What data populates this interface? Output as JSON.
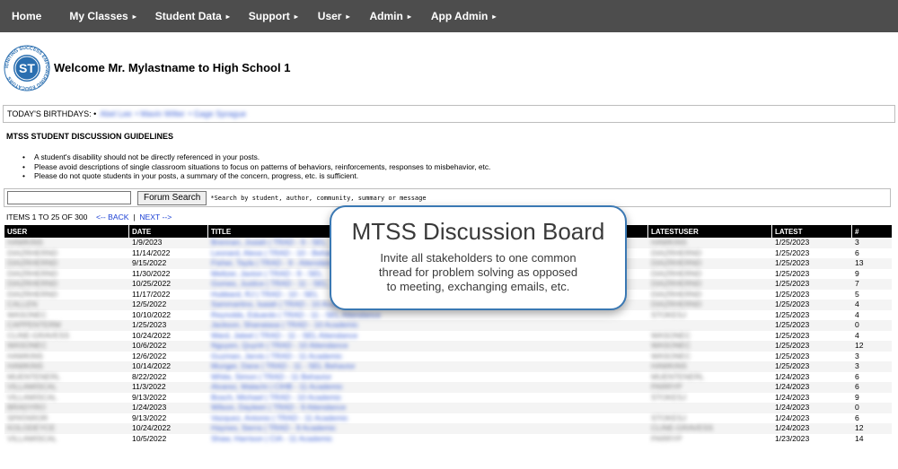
{
  "nav": {
    "home": "Home",
    "my_classes": "My Classes",
    "student_data": "Student Data",
    "support": "Support",
    "user": "User",
    "admin": "Admin",
    "app_admin": "App Admin",
    "arrow": "▸"
  },
  "header": {
    "welcome": "Welcome Mr. Mylastname to High School 1",
    "logo_text": "ST",
    "logo_ring_text": "IGNITING SUCCESS EMPOWERING EDUCATORS"
  },
  "birthdays": {
    "label": "TODAY'S BIRTHDAYS: •",
    "names": [
      "Abel Lee",
      "• Mavin Wilter",
      "• Gage Sprague"
    ]
  },
  "guidelines": {
    "title": "MTSS STUDENT DISCUSSION GUIDELINES",
    "items": [
      "A student's disability should not be directly referenced in your posts.",
      "Please avoid descriptions of single classroom situations to focus on patterns of behaviors, reinforcements, responses to misbehavior, etc.",
      "Please do not quote students in your posts, a summary of the concern, progress, etc. is sufficient."
    ]
  },
  "search": {
    "value": "",
    "button": "Forum Search",
    "hint": "*Search by student, author, community, summary or message"
  },
  "pagination": {
    "items_text": "ITEMS 1 TO 25 OF 300",
    "back": "<-- BACK",
    "separator": "|",
    "next": "NEXT -->"
  },
  "table": {
    "headers": {
      "user": "USER",
      "date": "DATE",
      "title": "TITLE",
      "lastuser": "LATESTUSER",
      "latest": "LATEST",
      "count": "#"
    },
    "rows": [
      {
        "user": "HAWKINS",
        "date": "1/9/2023",
        "title": "Brennan, Josiah | TRAD - 9 - SEL",
        "lastuser": "HAWKINS",
        "latest": "1/25/2023",
        "count": "3"
      },
      {
        "user": "DIAZRHERND",
        "date": "11/14/2022",
        "title": "Leonard, Alexa | TRAD - 10 - Behavior",
        "lastuser": "DIAZRHERND",
        "latest": "1/25/2023",
        "count": "6"
      },
      {
        "user": "DIAZRHERND",
        "date": "9/15/2022",
        "title": "Fisher, Tayla | TRAD - 9 - Attendance",
        "lastuser": "DIAZRHERND",
        "latest": "1/25/2023",
        "count": "13"
      },
      {
        "user": "DIAZRHERND",
        "date": "11/30/2022",
        "title": "Meltzer, Jaxton | TRAD - 9 - SEL",
        "lastuser": "DIAZRHERND",
        "latest": "1/25/2023",
        "count": "9"
      },
      {
        "user": "DIAZRHERND",
        "date": "10/25/2022",
        "title": "Gomes, Justice | TRAD - 11 - SEL",
        "lastuser": "DIAZRHERND",
        "latest": "1/25/2023",
        "count": "7"
      },
      {
        "user": "DIAZRHERND",
        "date": "11/17/2022",
        "title": "Hubbard, RJ | TRAD - 10 - SEL",
        "lastuser": "DIAZRHERND",
        "latest": "1/25/2023",
        "count": "5"
      },
      {
        "user": "CALLEN",
        "date": "12/5/2022",
        "title": "Sammartino, Isaiah | TRAD - 10 Academic",
        "lastuser": "DIAZRHERND",
        "latest": "1/25/2023",
        "count": "4"
      },
      {
        "user": "WASONEC",
        "date": "10/10/2022",
        "title": "Reynolds, Eduardo | TRAD - 11 - SEL Attendance",
        "lastuser": "STOKESJ",
        "latest": "1/25/2023",
        "count": "4"
      },
      {
        "user": "CAPPENTERM",
        "date": "1/25/2023",
        "title": "Jackson, Shanaiasa | TRAD - 10 Academic",
        "lastuser": "",
        "latest": "1/25/2023",
        "count": "0"
      },
      {
        "user": "CLINE-GRAVESS",
        "date": "10/24/2022",
        "title": "Ward, Jaleel | TRAD - 11 - SEL Attendance",
        "lastuser": "WASONEC",
        "latest": "1/25/2023",
        "count": "4"
      },
      {
        "user": "WASONEC",
        "date": "10/6/2022",
        "title": "Nguyen, Quynh | TRAD - 10 Attendance",
        "lastuser": "WASONEC",
        "latest": "1/25/2023",
        "count": "12"
      },
      {
        "user": "HAWKINS",
        "date": "12/6/2022",
        "title": "Guzman, Jarvis | TRAD - 11 Academic",
        "lastuser": "WASONEC",
        "latest": "1/25/2023",
        "count": "3"
      },
      {
        "user": "HAWKINS",
        "date": "10/14/2022",
        "title": "Munger, Dane | TRAD - 11 - SEL Behavior",
        "lastuser": "HAWKINS",
        "latest": "1/25/2023",
        "count": "3"
      },
      {
        "user": "MUENTENERL",
        "date": "8/22/2022",
        "title": "White, Simon | TRAD - 11 Behavior",
        "lastuser": "MUENTENERL",
        "latest": "1/24/2023",
        "count": "6"
      },
      {
        "user": "VILLAMISCAL",
        "date": "11/3/2022",
        "title": "Alvarez, Malachi | CIHB - 11 Academic",
        "lastuser": "PARRYP",
        "latest": "1/24/2023",
        "count": "6"
      },
      {
        "user": "VILLAMISCAL",
        "date": "9/13/2022",
        "title": "Bosch, Michael | TRAD - 10 Academic",
        "lastuser": "STOKESJ",
        "latest": "1/24/2023",
        "count": "9"
      },
      {
        "user": "BRADYRO",
        "date": "1/24/2023",
        "title": "Wilson, Dayleen | TRAD - 9 Attendance",
        "lastuser": "",
        "latest": "1/24/2023",
        "count": "0"
      },
      {
        "user": "SPATAROR",
        "date": "9/13/2022",
        "title": "Vazquez, Antonio | TRAD - 11 Academic",
        "lastuser": "STOKESJ",
        "latest": "1/24/2023",
        "count": "6"
      },
      {
        "user": "KOLODEYCE",
        "date": "10/24/2022",
        "title": "Haynes, Sierra | TRAD - 9 Academic",
        "lastuser": "CLINE-GRAVESS",
        "latest": "1/24/2023",
        "count": "12"
      },
      {
        "user": "VILLAMISCAL",
        "date": "10/5/2022",
        "title": "Shaw, Harrison | CIA - 11 Academic",
        "lastuser": "PARRYP",
        "latest": "1/23/2023",
        "count": "14"
      }
    ]
  },
  "callout": {
    "title": "MTSS Discussion Board",
    "line1": "Invite all stakeholders to one common",
    "line2": "thread for problem solving as opposed",
    "line3": "to meeting, exchanging emails, etc."
  },
  "colors": {
    "nav_bg": "#4d4d4d",
    "link": "#1a3fd4",
    "callout_border": "#3a78b3"
  }
}
